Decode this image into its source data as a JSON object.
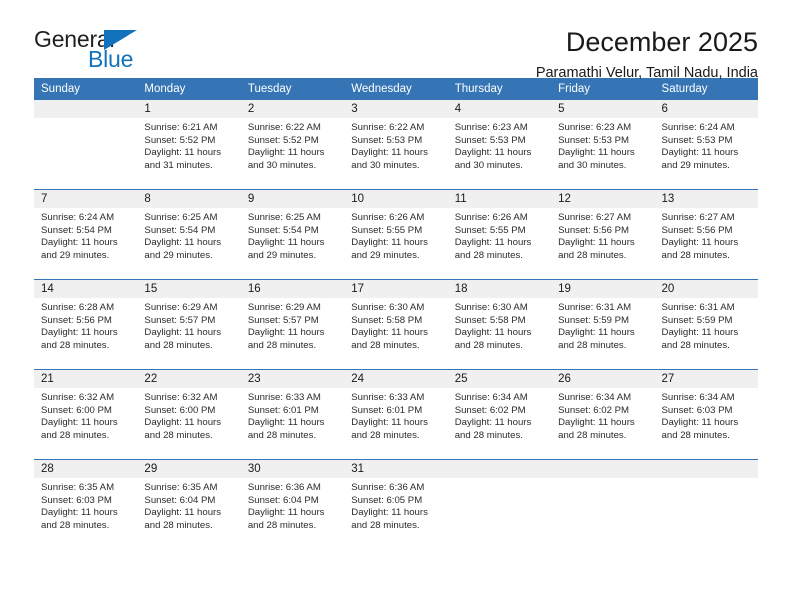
{
  "brand": {
    "name_top": "General",
    "name_bottom": "Blue",
    "accent_color": "#1272bb"
  },
  "header": {
    "title": "December 2025",
    "subtitle": "Paramathi Velur, Tamil Nadu, India",
    "header_bg_color": "#3575b5"
  },
  "calendar": {
    "weekday_headers": [
      "Sunday",
      "Monday",
      "Tuesday",
      "Wednesday",
      "Thursday",
      "Friday",
      "Saturday"
    ],
    "labels": {
      "sunrise_prefix": "Sunrise:",
      "sunset_prefix": "Sunset:",
      "daylight_prefix": "Daylight:"
    },
    "weeks": [
      [
        {
          "day": "",
          "blank": true
        },
        {
          "day": "1",
          "sunrise": "Sunrise: 6:21 AM",
          "sunset": "Sunset: 5:52 PM",
          "daylight": "Daylight: 11 hours and 31 minutes."
        },
        {
          "day": "2",
          "sunrise": "Sunrise: 6:22 AM",
          "sunset": "Sunset: 5:52 PM",
          "daylight": "Daylight: 11 hours and 30 minutes."
        },
        {
          "day": "3",
          "sunrise": "Sunrise: 6:22 AM",
          "sunset": "Sunset: 5:53 PM",
          "daylight": "Daylight: 11 hours and 30 minutes."
        },
        {
          "day": "4",
          "sunrise": "Sunrise: 6:23 AM",
          "sunset": "Sunset: 5:53 PM",
          "daylight": "Daylight: 11 hours and 30 minutes."
        },
        {
          "day": "5",
          "sunrise": "Sunrise: 6:23 AM",
          "sunset": "Sunset: 5:53 PM",
          "daylight": "Daylight: 11 hours and 30 minutes."
        },
        {
          "day": "6",
          "sunrise": "Sunrise: 6:24 AM",
          "sunset": "Sunset: 5:53 PM",
          "daylight": "Daylight: 11 hours and 29 minutes."
        }
      ],
      [
        {
          "day": "7",
          "sunrise": "Sunrise: 6:24 AM",
          "sunset": "Sunset: 5:54 PM",
          "daylight": "Daylight: 11 hours and 29 minutes."
        },
        {
          "day": "8",
          "sunrise": "Sunrise: 6:25 AM",
          "sunset": "Sunset: 5:54 PM",
          "daylight": "Daylight: 11 hours and 29 minutes."
        },
        {
          "day": "9",
          "sunrise": "Sunrise: 6:25 AM",
          "sunset": "Sunset: 5:54 PM",
          "daylight": "Daylight: 11 hours and 29 minutes."
        },
        {
          "day": "10",
          "sunrise": "Sunrise: 6:26 AM",
          "sunset": "Sunset: 5:55 PM",
          "daylight": "Daylight: 11 hours and 29 minutes."
        },
        {
          "day": "11",
          "sunrise": "Sunrise: 6:26 AM",
          "sunset": "Sunset: 5:55 PM",
          "daylight": "Daylight: 11 hours and 28 minutes."
        },
        {
          "day": "12",
          "sunrise": "Sunrise: 6:27 AM",
          "sunset": "Sunset: 5:56 PM",
          "daylight": "Daylight: 11 hours and 28 minutes."
        },
        {
          "day": "13",
          "sunrise": "Sunrise: 6:27 AM",
          "sunset": "Sunset: 5:56 PM",
          "daylight": "Daylight: 11 hours and 28 minutes."
        }
      ],
      [
        {
          "day": "14",
          "sunrise": "Sunrise: 6:28 AM",
          "sunset": "Sunset: 5:56 PM",
          "daylight": "Daylight: 11 hours and 28 minutes."
        },
        {
          "day": "15",
          "sunrise": "Sunrise: 6:29 AM",
          "sunset": "Sunset: 5:57 PM",
          "daylight": "Daylight: 11 hours and 28 minutes."
        },
        {
          "day": "16",
          "sunrise": "Sunrise: 6:29 AM",
          "sunset": "Sunset: 5:57 PM",
          "daylight": "Daylight: 11 hours and 28 minutes."
        },
        {
          "day": "17",
          "sunrise": "Sunrise: 6:30 AM",
          "sunset": "Sunset: 5:58 PM",
          "daylight": "Daylight: 11 hours and 28 minutes."
        },
        {
          "day": "18",
          "sunrise": "Sunrise: 6:30 AM",
          "sunset": "Sunset: 5:58 PM",
          "daylight": "Daylight: 11 hours and 28 minutes."
        },
        {
          "day": "19",
          "sunrise": "Sunrise: 6:31 AM",
          "sunset": "Sunset: 5:59 PM",
          "daylight": "Daylight: 11 hours and 28 minutes."
        },
        {
          "day": "20",
          "sunrise": "Sunrise: 6:31 AM",
          "sunset": "Sunset: 5:59 PM",
          "daylight": "Daylight: 11 hours and 28 minutes."
        }
      ],
      [
        {
          "day": "21",
          "sunrise": "Sunrise: 6:32 AM",
          "sunset": "Sunset: 6:00 PM",
          "daylight": "Daylight: 11 hours and 28 minutes."
        },
        {
          "day": "22",
          "sunrise": "Sunrise: 6:32 AM",
          "sunset": "Sunset: 6:00 PM",
          "daylight": "Daylight: 11 hours and 28 minutes."
        },
        {
          "day": "23",
          "sunrise": "Sunrise: 6:33 AM",
          "sunset": "Sunset: 6:01 PM",
          "daylight": "Daylight: 11 hours and 28 minutes."
        },
        {
          "day": "24",
          "sunrise": "Sunrise: 6:33 AM",
          "sunset": "Sunset: 6:01 PM",
          "daylight": "Daylight: 11 hours and 28 minutes."
        },
        {
          "day": "25",
          "sunrise": "Sunrise: 6:34 AM",
          "sunset": "Sunset: 6:02 PM",
          "daylight": "Daylight: 11 hours and 28 minutes."
        },
        {
          "day": "26",
          "sunrise": "Sunrise: 6:34 AM",
          "sunset": "Sunset: 6:02 PM",
          "daylight": "Daylight: 11 hours and 28 minutes."
        },
        {
          "day": "27",
          "sunrise": "Sunrise: 6:34 AM",
          "sunset": "Sunset: 6:03 PM",
          "daylight": "Daylight: 11 hours and 28 minutes."
        }
      ],
      [
        {
          "day": "28",
          "sunrise": "Sunrise: 6:35 AM",
          "sunset": "Sunset: 6:03 PM",
          "daylight": "Daylight: 11 hours and 28 minutes."
        },
        {
          "day": "29",
          "sunrise": "Sunrise: 6:35 AM",
          "sunset": "Sunset: 6:04 PM",
          "daylight": "Daylight: 11 hours and 28 minutes."
        },
        {
          "day": "30",
          "sunrise": "Sunrise: 6:36 AM",
          "sunset": "Sunset: 6:04 PM",
          "daylight": "Daylight: 11 hours and 28 minutes."
        },
        {
          "day": "31",
          "sunrise": "Sunrise: 6:36 AM",
          "sunset": "Sunset: 6:05 PM",
          "daylight": "Daylight: 11 hours and 28 minutes."
        },
        {
          "day": "",
          "blank": true
        },
        {
          "day": "",
          "blank": true
        },
        {
          "day": "",
          "blank": true
        }
      ]
    ]
  }
}
